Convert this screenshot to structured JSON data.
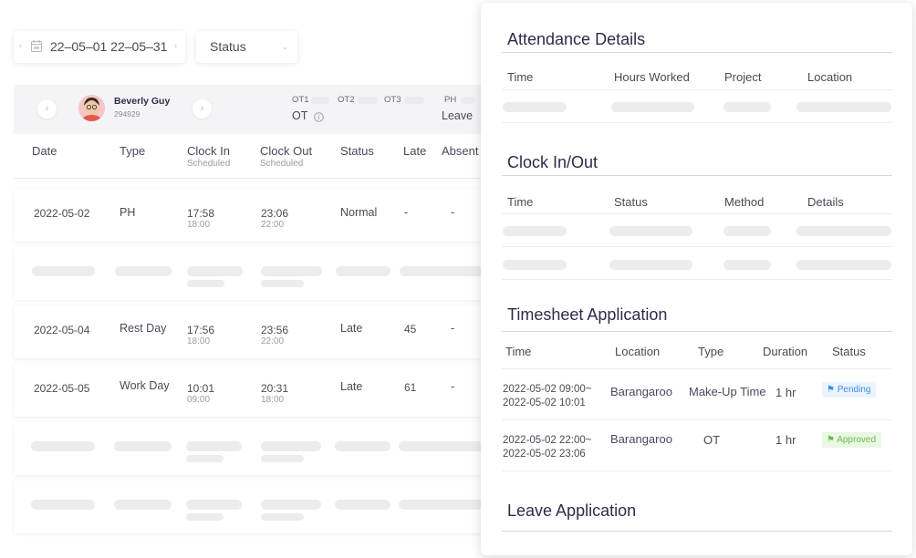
{
  "filters": {
    "date_range": "22–05–01 22–05–31",
    "status_label": "Status"
  },
  "employee": {
    "name": "Beverly Guy",
    "id": "294929",
    "ot_labels": [
      "OT1",
      "OT2",
      "OT3"
    ],
    "ot_label": "OT",
    "ph_label": "PH",
    "leave_label": "Leave"
  },
  "table": {
    "headers": {
      "date": "Date",
      "type": "Type",
      "clock_in": "Clock In",
      "clock_in_sub": "Scheduled",
      "clock_out": "Clock Out",
      "clock_out_sub": "Scheduled",
      "status": "Status",
      "late": "Late",
      "absent": "Absent"
    },
    "rows": [
      {
        "date": "2022-05-02",
        "type": "PH",
        "clock_in": "17:58",
        "clock_in_sched": "18:00",
        "clock_out": "23:06",
        "clock_out_sched": "22:00",
        "status": "Normal",
        "late": "-",
        "absent": "-"
      },
      {
        "date": "2022-05-04",
        "type": "Rest Day",
        "clock_in": "17:56",
        "clock_in_sched": "18:00",
        "clock_out": "23:56",
        "clock_out_sched": "22:00",
        "status": "Late",
        "late": "45",
        "absent": "-"
      },
      {
        "date": "2022-05-05",
        "type": "Work Day",
        "clock_in": "10:01",
        "clock_in_sched": "09:00",
        "clock_out": "20:31",
        "clock_out_sched": "18:00",
        "status": "Late",
        "late": "61",
        "absent": "-"
      }
    ]
  },
  "panel": {
    "attendance": {
      "title": "Attendance Details",
      "headers": [
        "Time",
        "Hours Worked",
        "Project",
        "Location"
      ]
    },
    "clock": {
      "title": "Clock In/Out",
      "headers": [
        "Time",
        "Status",
        "Method",
        "Details"
      ]
    },
    "timesheet": {
      "title": "Timesheet Application",
      "headers": [
        "Time",
        "Location",
        "Type",
        "Duration",
        "Status"
      ],
      "rows": [
        {
          "time_start": "2022-05-02 09:00~",
          "time_end": "2022-05-02 10:01",
          "location": "Barangaroo",
          "type": "Make-Up Time",
          "duration": "1 hr",
          "status": "Pending"
        },
        {
          "time_start": "2022-05-02 22:00~",
          "time_end": "2022-05-02 23:06",
          "location": "Barangaroo",
          "type": "OT",
          "duration": "1 hr",
          "status": "Approved"
        }
      ]
    },
    "leave": {
      "title": "Leave Application"
    }
  },
  "colors": {
    "pending": "#3b8fe8",
    "approved": "#6bbd4a",
    "skeleton": "#ececef",
    "title": "#2c2c4a"
  }
}
